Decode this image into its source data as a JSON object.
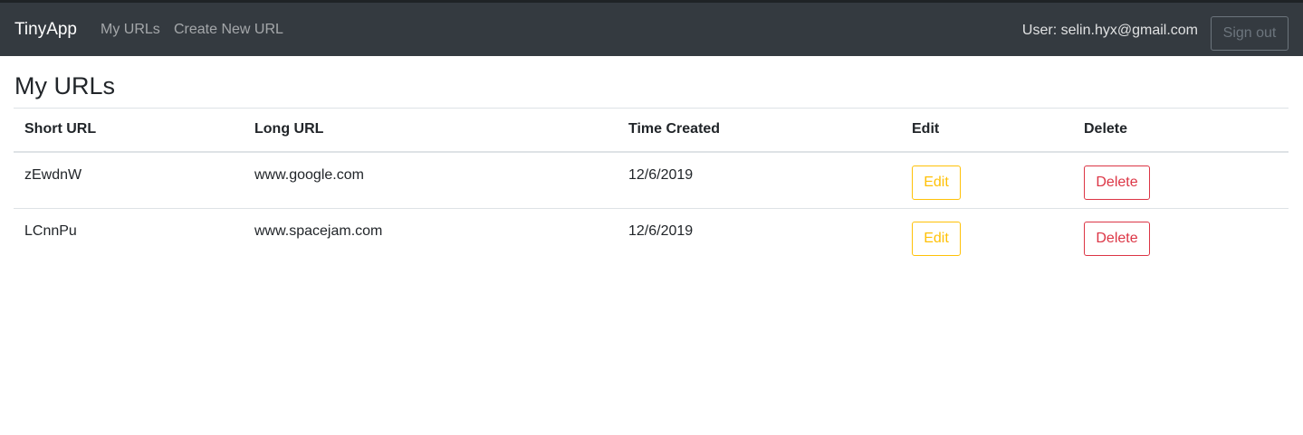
{
  "navbar": {
    "brand": "TinyApp",
    "links": [
      "My URLs",
      "Create New URL"
    ],
    "user_label": "User: selin.hyx@gmail.com",
    "signout_label": "Sign out"
  },
  "page": {
    "title": "My URLs"
  },
  "table": {
    "headers": [
      "Short URL",
      "Long URL",
      "Time Created",
      "Edit",
      "Delete"
    ],
    "rows": [
      {
        "short_url": "zEwdnW",
        "long_url": "www.google.com",
        "time_created": "12/6/2019",
        "edit_label": "Edit",
        "delete_label": "Delete"
      },
      {
        "short_url": "LCnnPu",
        "long_url": "www.spacejam.com",
        "time_created": "12/6/2019",
        "edit_label": "Edit",
        "delete_label": "Delete"
      }
    ]
  },
  "colors": {
    "navbar_bg": "#343a40",
    "edit_accent": "#ffc107",
    "delete_accent": "#dc3545",
    "signout_border": "#6c757d"
  }
}
